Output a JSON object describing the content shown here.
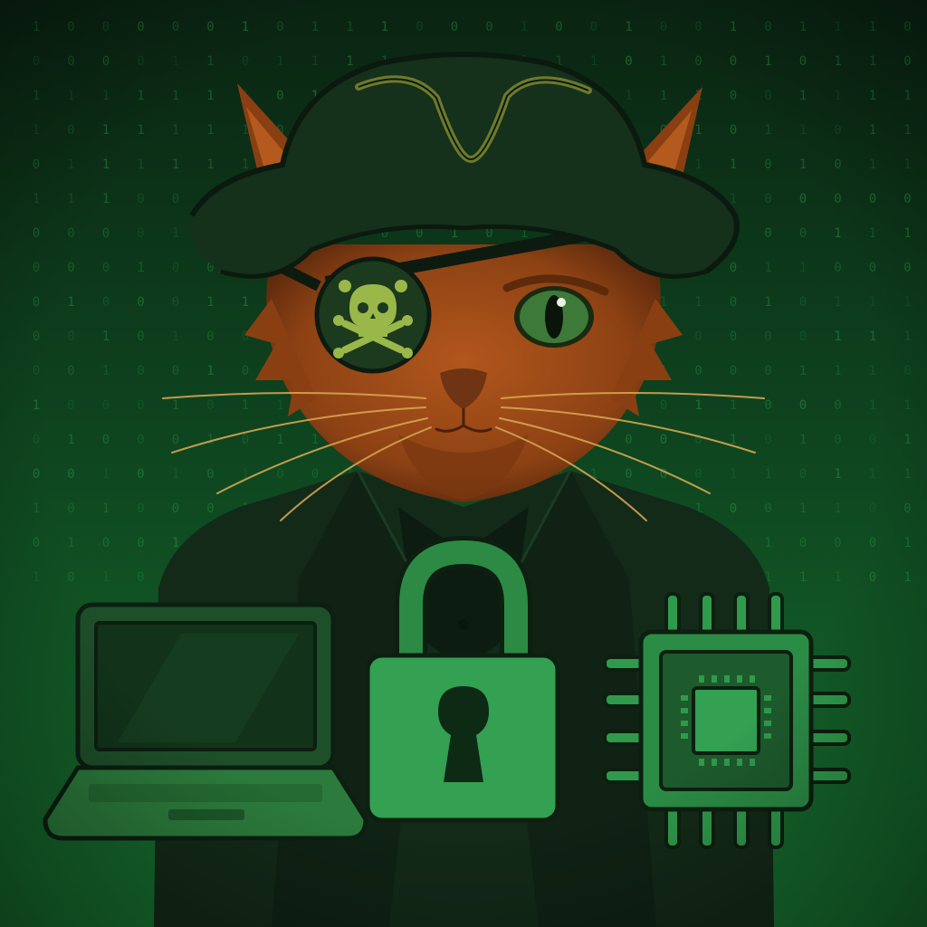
{
  "scene": {
    "subject": "pirate-cat",
    "colors": {
      "background_top": "#0a2412",
      "background_bottom": "#17712f",
      "matrix_digit": "#2f9f4c",
      "accent_green": "#39a85a",
      "fur_orange": "#a24e18",
      "fur_dark": "#5e2a0c",
      "hat": "#15301b",
      "hat_trim": "#6e7a2c",
      "coat": "#132a18",
      "eye": "#3d7a3a"
    },
    "matrix": {
      "columns": 26,
      "rows": 17,
      "digits": [
        "0",
        "1"
      ]
    },
    "icons": [
      "laptop-icon",
      "padlock-icon",
      "microchip-icon",
      "skull-crossbones-icon",
      "eye-patch-icon"
    ]
  }
}
